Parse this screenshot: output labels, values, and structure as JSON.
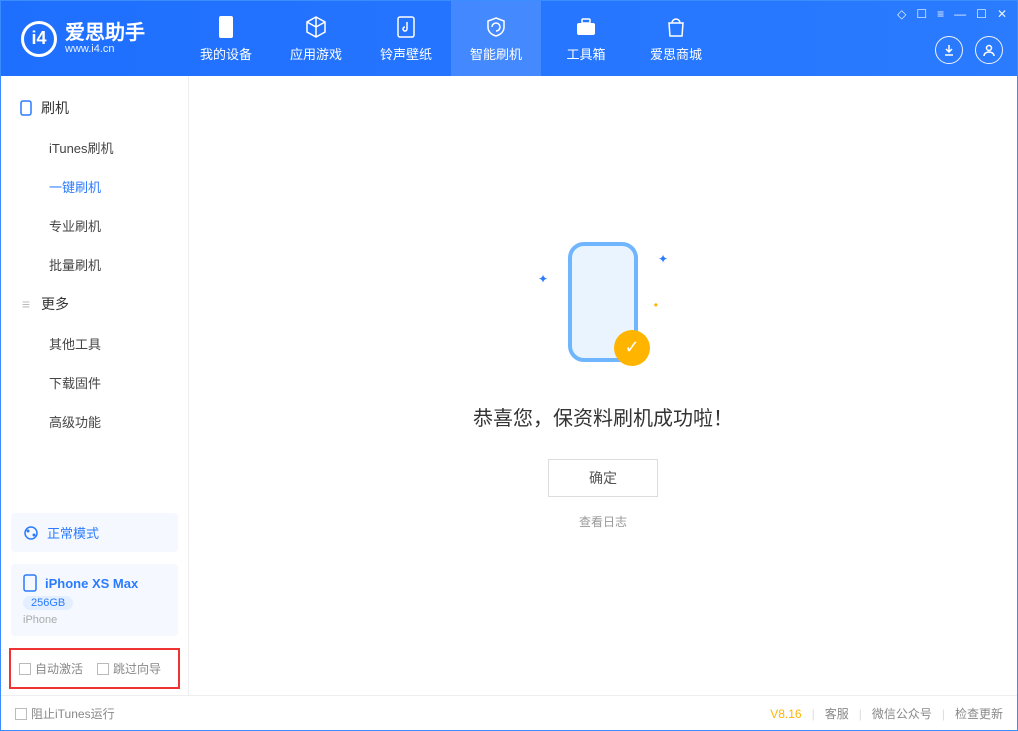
{
  "app": {
    "title": "爱思助手",
    "subtitle": "www.i4.cn"
  },
  "nav": {
    "items": [
      {
        "label": "我的设备"
      },
      {
        "label": "应用游戏"
      },
      {
        "label": "铃声壁纸"
      },
      {
        "label": "智能刷机"
      },
      {
        "label": "工具箱"
      },
      {
        "label": "爱思商城"
      }
    ]
  },
  "sidebar": {
    "section1_title": "刷机",
    "section1_items": [
      "iTunes刷机",
      "一键刷机",
      "专业刷机",
      "批量刷机"
    ],
    "section2_title": "更多",
    "section2_items": [
      "其他工具",
      "下载固件",
      "高级功能"
    ]
  },
  "mode": {
    "label": "正常模式"
  },
  "device": {
    "name": "iPhone XS Max",
    "capacity": "256GB",
    "type": "iPhone"
  },
  "checkboxes": {
    "auto_activate": "自动激活",
    "skip_guide": "跳过向导"
  },
  "main": {
    "message": "恭喜您，保资料刷机成功啦！",
    "ok_button": "确定",
    "log_link": "查看日志"
  },
  "footer": {
    "block_itunes": "阻止iTunes运行",
    "version": "V8.16",
    "links": [
      "客服",
      "微信公众号",
      "检查更新"
    ]
  }
}
